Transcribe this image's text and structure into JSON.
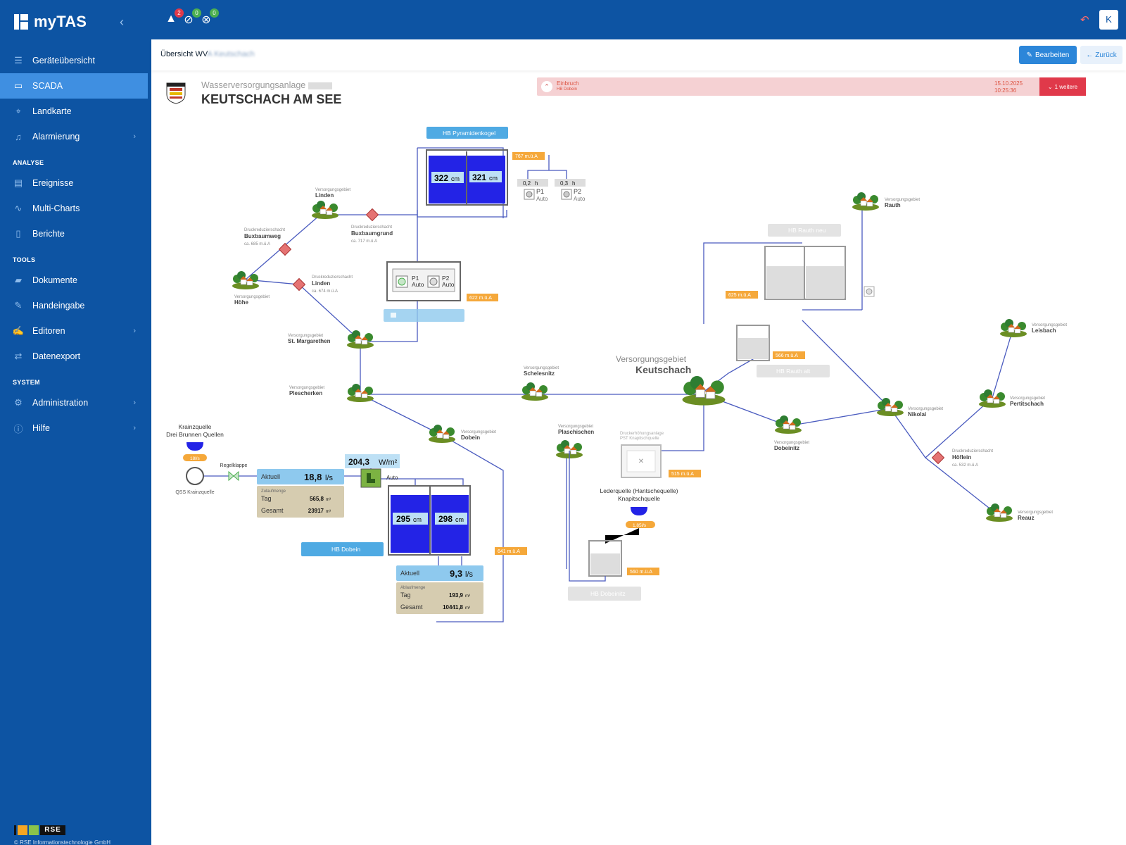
{
  "app": {
    "name": "myTAS"
  },
  "sidebar": {
    "items": [
      {
        "label": "Geräteübersicht",
        "icon": "list-icon"
      },
      {
        "label": "SCADA",
        "icon": "monitor-icon"
      },
      {
        "label": "Landkarte",
        "icon": "map-pin-icon"
      },
      {
        "label": "Alarmierung",
        "icon": "bell-icon"
      }
    ],
    "section_analyse": "ANALYSE",
    "analyse_items": [
      {
        "label": "Ereignisse",
        "icon": "table-icon"
      },
      {
        "label": "Multi-Charts",
        "icon": "chart-line-icon"
      },
      {
        "label": "Berichte",
        "icon": "document-icon"
      }
    ],
    "section_tools": "TOOLS",
    "tools_items": [
      {
        "label": "Dokumente",
        "icon": "folder-icon"
      },
      {
        "label": "Handeingabe",
        "icon": "pencil-icon"
      },
      {
        "label": "Editoren",
        "icon": "edit-icon"
      },
      {
        "label": "Datenexport",
        "icon": "shuffle-icon"
      }
    ],
    "section_system": "SYSTEM",
    "system_items": [
      {
        "label": "Administration",
        "icon": "gears-icon"
      },
      {
        "label": "Hilfe",
        "icon": "info-icon"
      }
    ],
    "footer_logo": "RSE",
    "copyright": "© RSE Informationstechnologie GmbH"
  },
  "topbar": {
    "alerts": [
      {
        "icon": "warning-icon",
        "count": "2",
        "color": "#e0394a"
      },
      {
        "icon": "eye-off-icon",
        "count": "0",
        "color": "#4caf50"
      },
      {
        "icon": "bell-off-icon",
        "count": "0",
        "color": "#4caf50"
      }
    ],
    "user_initial": "K"
  },
  "header": {
    "breadcrumb": "Übersicht WV",
    "breadcrumb_blurred": "A Keutschach",
    "edit_label": "Bearbeiten",
    "back_label": "Zurück"
  },
  "plant": {
    "subtitle": "Wasserversorgungsanlage",
    "title": "KEUTSCHACH AM SEE"
  },
  "alarm": {
    "type": "Einbruch",
    "source": "HB Dobein",
    "date": "15.10.2025",
    "time": "10:25:36",
    "more_label": "1 weitere"
  },
  "scada": {
    "hb_pyramidenkogel": {
      "label": "HB Pyramidenkogel",
      "level1": "322",
      "level2": "321",
      "unit": "cm",
      "elevation": "767 m.ü.A",
      "p1_hours": "0,2",
      "p2_hours": "0,3",
      "hours_unit": "h",
      "p1_label": "P1",
      "p2_label": "P2",
      "mode": "Auto"
    },
    "pump_station": {
      "p1_label": "P1",
      "p2_label": "P2",
      "mode": "Auto",
      "elevation": "622 m.ü.A"
    },
    "hb_rauth_neu": {
      "label": "HB Rauth neu",
      "elevation": "625 m.ü.A"
    },
    "hb_rauth_alt": {
      "label": "HB Rauth alt",
      "elevation": "566 m.ü.A"
    },
    "hb_dobein": {
      "label": "HB Dobein",
      "level1": "295",
      "level2": "298",
      "unit": "cm",
      "elevation": "641 m.ü.A",
      "current_label": "Aktuell",
      "current_value": "9,3",
      "flow_unit": "l/s",
      "sum_title": "Ablaufmenge",
      "day_label": "Tag",
      "day_value": "193,9",
      "total_label": "Gesamt",
      "total_value": "10441,8",
      "volume_unit": "m³"
    },
    "inflow": {
      "current_label": "Aktuell",
      "current_value": "18,8",
      "flow_unit": "l/s",
      "sum_title": "Zulaufmenge",
      "day_label": "Tag",
      "day_value": "565,8",
      "total_label": "Gesamt",
      "total_value": "23917",
      "volume_unit": "m³",
      "radiation": "204,3",
      "radiation_unit": "W/m²",
      "mode": "Auto"
    },
    "krainzquelle": {
      "title": "Krainzquelle",
      "subtitle": "Drei Brunnen Quellen",
      "flow": "18l/s",
      "valve_label": "Regelklappe",
      "qss_label": "QSS Krainzquelle"
    },
    "lederquelle": {
      "title": "Lederquelle (Hantschequelle)",
      "subtitle": "Knapitschquelle",
      "flow": "1,85l/s"
    },
    "hb_dobeinitz": {
      "label": "HB Dobeinitz",
      "elevation": "560 m.ü.A"
    },
    "pressure_station": {
      "title": "Druckerhöhungsanlage",
      "subtitle": "PST Knapitschquelle",
      "elevation": "515 m.ü.A"
    },
    "main_area": {
      "prefix": "Versorgungsgebiet",
      "name": "Keutschach"
    },
    "area_prefix": "Versorgungsgebiet",
    "areas": [
      "Linden",
      "Höhe",
      "St. Margarethen",
      "Plescherken",
      "Schelesnitz",
      "Dobein",
      "Plaschischen",
      "Dobeinitz",
      "Nikolai",
      "Rauth",
      "Leisbach",
      "Pertitschach",
      "Reauz"
    ],
    "valve_prefix": "Druckreduzierschacht",
    "valves": [
      {
        "name": "Buxbaumweg",
        "elevation": "ca. 685 m.ü.A"
      },
      {
        "name": "Buxbaumgrund",
        "elevation": "ca. 717 m.ü.A"
      },
      {
        "name": "Linden",
        "elevation": "ca. 674 m.ü.A"
      },
      {
        "name": "Höflein",
        "elevation": "ca. 532 m.ü.A"
      }
    ]
  },
  "colors": {
    "sidebar": "#0d54a3",
    "active": "#3f8fe1",
    "water": "#2323e6",
    "pipe": "#4a5bbf",
    "elevation_tag": "#f5a83a",
    "alarm": "#e0394a"
  }
}
